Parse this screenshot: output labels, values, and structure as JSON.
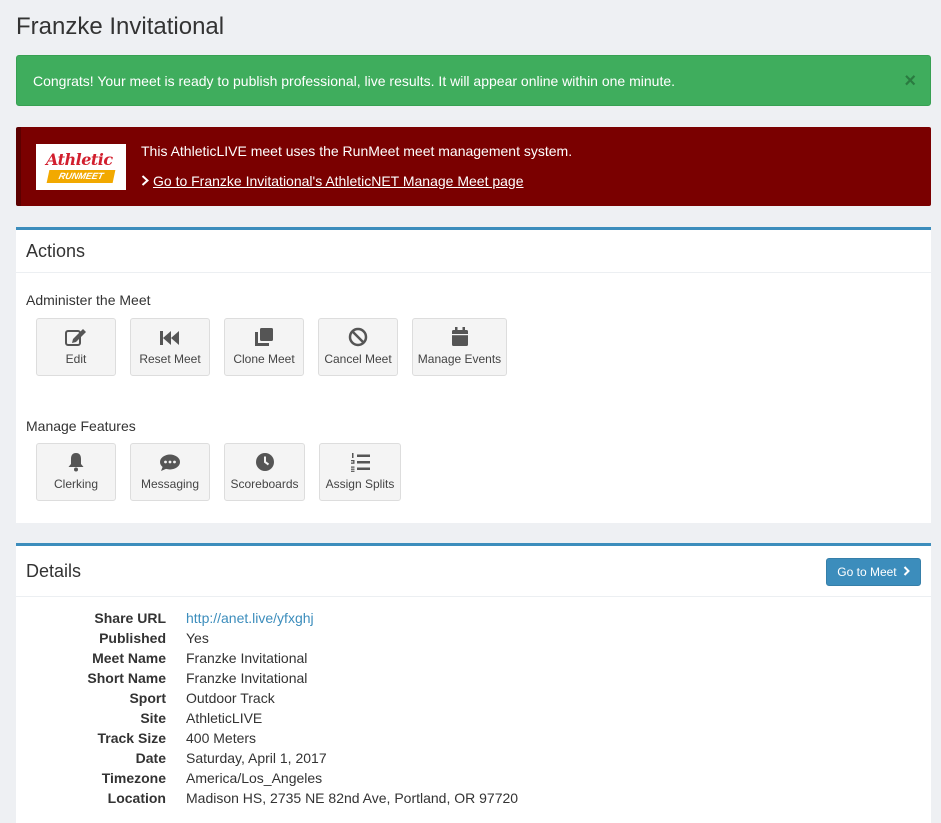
{
  "page": {
    "title": "Franzke Invitational"
  },
  "alert": {
    "message": "Congrats! Your meet is ready to publish professional, live results. It will appear online within one minute.",
    "close_glyph": "×"
  },
  "banner": {
    "logo_top": "Athletic",
    "logo_bottom": "RUNMEET",
    "text": "This AthleticLIVE meet uses the RunMeet meet management system.",
    "link": "Go to Franzke Invitational's AthleticNET Manage Meet page"
  },
  "actions": {
    "title": "Actions",
    "administer_label": "Administer the Meet",
    "administer": [
      {
        "label": "Edit",
        "icon": "edit-icon"
      },
      {
        "label": "Reset Meet",
        "icon": "fast-backward-icon"
      },
      {
        "label": "Clone Meet",
        "icon": "clone-icon"
      },
      {
        "label": "Cancel Meet",
        "icon": "ban-icon"
      },
      {
        "label": "Manage Events",
        "icon": "calendar-icon"
      }
    ],
    "features_label": "Manage Features",
    "features": [
      {
        "label": "Clerking",
        "icon": "bell-icon"
      },
      {
        "label": "Messaging",
        "icon": "comment-icon"
      },
      {
        "label": "Scoreboards",
        "icon": "clock-icon"
      },
      {
        "label": "Assign Splits",
        "icon": "list-ol-icon"
      }
    ]
  },
  "details": {
    "title": "Details",
    "go_button": "Go to Meet",
    "rows": [
      {
        "label": "Share URL",
        "value": "http://anet.live/yfxghj"
      },
      {
        "label": "Published",
        "value": "Yes"
      },
      {
        "label": "Meet Name",
        "value": "Franzke Invitational"
      },
      {
        "label": "Short Name",
        "value": "Franzke Invitational"
      },
      {
        "label": "Sport",
        "value": "Outdoor Track"
      },
      {
        "label": "Site",
        "value": "AthleticLIVE"
      },
      {
        "label": "Track Size",
        "value": "400 Meters"
      },
      {
        "label": "Date",
        "value": "Saturday, April 1, 2017"
      },
      {
        "label": "Timezone",
        "value": "America/Los_Angeles"
      },
      {
        "label": "Location",
        "value": "Madison HS, 2735 NE 82nd Ave, Portland, OR 97720"
      }
    ]
  },
  "colors": {
    "success": "#3fad5d",
    "banner": "#7a0000",
    "primary": "#3c8dbc"
  }
}
